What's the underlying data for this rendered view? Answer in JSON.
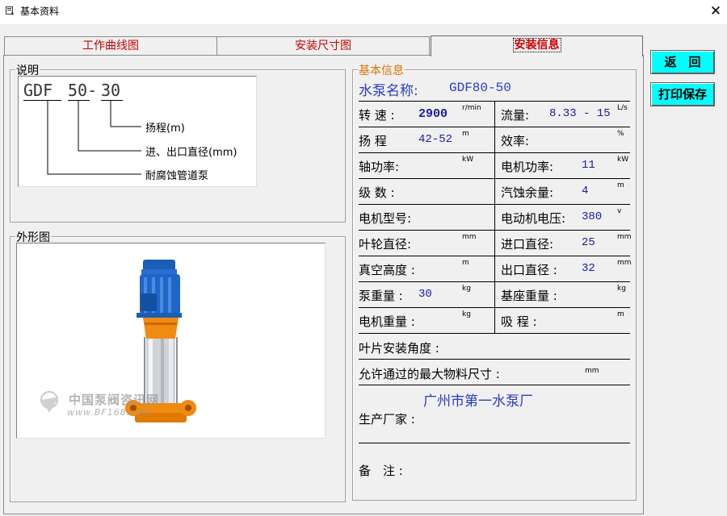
{
  "window": {
    "title": "基本资料",
    "close": "✕"
  },
  "tabs": [
    "工作曲线图",
    "安装尺寸图",
    "安装信息"
  ],
  "buttons": {
    "back": "返　回",
    "print_save": "打印保存"
  },
  "explanation": {
    "legend": "说明",
    "model_parts": [
      "GDF",
      "50-",
      "30"
    ],
    "notes": [
      "扬程(m)",
      "进、出口直径(mm)",
      "耐腐蚀管道泵"
    ]
  },
  "appearance": {
    "legend": "外形图",
    "watermark_cn": "中国泵阀咨讯网",
    "watermark_url": "www.BF168.com"
  },
  "basic_info": {
    "legend": "基本信息",
    "pump_name_label": "水泵名称:",
    "pump_name_value": "GDF80-50",
    "rows": [
      {
        "l_label": "转 速 :",
        "l_value": "2900",
        "l_unit": "r/min",
        "r_label": "流量:",
        "r_value": "8.33 - 15",
        "r_unit": "L/s"
      },
      {
        "l_label": "扬 程",
        "l_value": "42-52",
        "l_unit": "m",
        "r_label": "效率:",
        "r_value": "",
        "r_unit": "%"
      },
      {
        "l_label": "轴功率:",
        "l_value": "",
        "l_unit": "kW",
        "r_label": "电机功率:",
        "r_value": "11",
        "r_unit": "kW"
      },
      {
        "l_label": "级 数 :",
        "l_value": "",
        "l_unit": "",
        "r_label": "汽蚀余量:",
        "r_value": "4",
        "r_unit": "m"
      },
      {
        "l_label": "电机型号:",
        "l_value": "",
        "l_unit": "",
        "r_label": "电动机电压:",
        "r_value": "380",
        "r_unit": "v"
      },
      {
        "l_label": "叶轮直径:",
        "l_value": "",
        "l_unit": "mm",
        "r_label": "进口直径:",
        "r_value": "25",
        "r_unit": "mm"
      },
      {
        "l_label": "真空高度 :",
        "l_value": "",
        "l_unit": "m",
        "r_label": "出口直径 :",
        "r_value": "32",
        "r_unit": "mm"
      },
      {
        "l_label": "泵重量 :",
        "l_value": "30",
        "l_unit": "kg",
        "r_label": "基座重量 :",
        "r_value": "",
        "r_unit": "kg"
      },
      {
        "l_label": "电机重量 :",
        "l_value": "",
        "l_unit": "kg",
        "r_label": "吸 程 :",
        "r_value": "",
        "r_unit": "m"
      }
    ],
    "blade_angle_label": "叶片安装角度 :",
    "max_particle_label": "允许通过的最大物料尺寸 :",
    "max_particle_unit": "mm",
    "manufacturer_label": "生产厂家 :",
    "manufacturer_value": "广州市第一水泵厂",
    "remarks_label": "备　注 :"
  }
}
